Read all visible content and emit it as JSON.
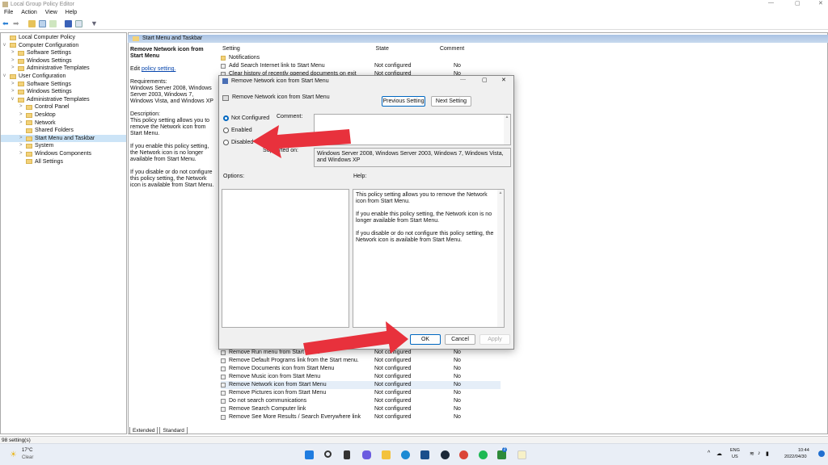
{
  "window": {
    "title": "Local Group Policy Editor"
  },
  "menu": [
    "File",
    "Action",
    "View",
    "Help"
  ],
  "tree": [
    {
      "label": "Local Computer Policy",
      "level": 0,
      "chev": ""
    },
    {
      "label": "Computer Configuration",
      "level": 0,
      "chev": "v"
    },
    {
      "label": "Software Settings",
      "level": 1,
      "chev": ">"
    },
    {
      "label": "Windows Settings",
      "level": 1,
      "chev": ">"
    },
    {
      "label": "Administrative Templates",
      "level": 1,
      "chev": ">"
    },
    {
      "label": "User Configuration",
      "level": 0,
      "chev": "v"
    },
    {
      "label": "Software Settings",
      "level": 1,
      "chev": ">"
    },
    {
      "label": "Windows Settings",
      "level": 1,
      "chev": ">"
    },
    {
      "label": "Administrative Templates",
      "level": 1,
      "chev": "v"
    },
    {
      "label": "Control Panel",
      "level": 2,
      "chev": ">"
    },
    {
      "label": "Desktop",
      "level": 2,
      "chev": ">"
    },
    {
      "label": "Network",
      "level": 2,
      "chev": ">"
    },
    {
      "label": "Shared Folders",
      "level": 2,
      "chev": ""
    },
    {
      "label": "Start Menu and Taskbar",
      "level": 2,
      "chev": ">",
      "selected": true
    },
    {
      "label": "System",
      "level": 2,
      "chev": ">"
    },
    {
      "label": "Windows Components",
      "level": 2,
      "chev": ">"
    },
    {
      "label": "All Settings",
      "level": 2,
      "chev": ""
    }
  ],
  "pane": {
    "header": "Start Menu and Taskbar",
    "desc_title": "Remove Network icon from Start Menu",
    "edit_prefix": "Edit ",
    "edit_link": "policy setting.",
    "requirements": "Requirements:\nWindows Server 2008, Windows Server 2003, Windows 7, Windows Vista, and Windows XP",
    "description": "Description:\nThis policy setting allows you to remove the Network icon from Start Menu.",
    "p1": "If you enable this policy setting, the Network icon is no longer available from Start Menu.",
    "p2": "If you disable or do not configure this policy setting, the Network icon is available from Start Menu."
  },
  "columns": {
    "setting": "Setting",
    "state": "State",
    "comment": "Comment"
  },
  "rows_top": [
    {
      "setting": "Notifications",
      "state": "",
      "comment": ""
    },
    {
      "setting": "Add Search Internet link to Start Menu",
      "state": "Not configured",
      "comment": "No"
    },
    {
      "setting": "Clear history of recently opened documents on exit",
      "state": "Not configured",
      "comment": "No"
    }
  ],
  "rows_bottom": [
    {
      "setting": "Remove Run menu from Start Menu",
      "state": "Not configured",
      "comment": "No"
    },
    {
      "setting": "Remove Default Programs link from the Start menu.",
      "state": "Not configured",
      "comment": "No"
    },
    {
      "setting": "Remove Documents icon from Start Menu",
      "state": "Not configured",
      "comment": "No"
    },
    {
      "setting": "Remove Music icon from Start Menu",
      "state": "Not configured",
      "comment": "No"
    },
    {
      "setting": "Remove Network icon from Start Menu",
      "state": "Not configured",
      "comment": "No",
      "selected": true
    },
    {
      "setting": "Remove Pictures icon from Start Menu",
      "state": "Not configured",
      "comment": "No"
    },
    {
      "setting": "Do not search communications",
      "state": "Not configured",
      "comment": "No"
    },
    {
      "setting": "Remove Search Computer link",
      "state": "Not configured",
      "comment": "No"
    },
    {
      "setting": "Remove See More Results / Search Everywhere link",
      "state": "Not configured",
      "comment": "No"
    }
  ],
  "tabs": [
    "Extended",
    "Standard"
  ],
  "status": "98 setting(s)",
  "dialog": {
    "title": "Remove Network icon from Start Menu",
    "subtitle": "Remove Network icon from Start Menu",
    "prev": "Previous Setting",
    "next": "Next Setting",
    "options": [
      "Not Configured",
      "Enabled",
      "Disabled"
    ],
    "selected": "Not Configured",
    "comment_label": "Comment:",
    "supported_label": "Supported on:",
    "supported": "Windows Server 2008, Windows Server 2003, Windows 7, Windows Vista, and Windows XP",
    "options_label": "Options:",
    "help_label": "Help:",
    "help": [
      "This policy setting allows you to remove the Network icon from Start Menu.",
      "If you enable this policy setting, the Network icon is no longer available from Start Menu.",
      "If you disable or do not configure this policy setting, the Network icon is available from Start Menu."
    ],
    "ok": "OK",
    "cancel": "Cancel",
    "apply": "Apply"
  },
  "taskbar": {
    "temp": "17°C",
    "weather": "Clear",
    "lang": "ENG",
    "region": "US",
    "time": "10:44",
    "date": "2022/04/30",
    "badge": "2"
  },
  "colors": {
    "arrow": "#e8313c",
    "accent": "#0067c0"
  }
}
